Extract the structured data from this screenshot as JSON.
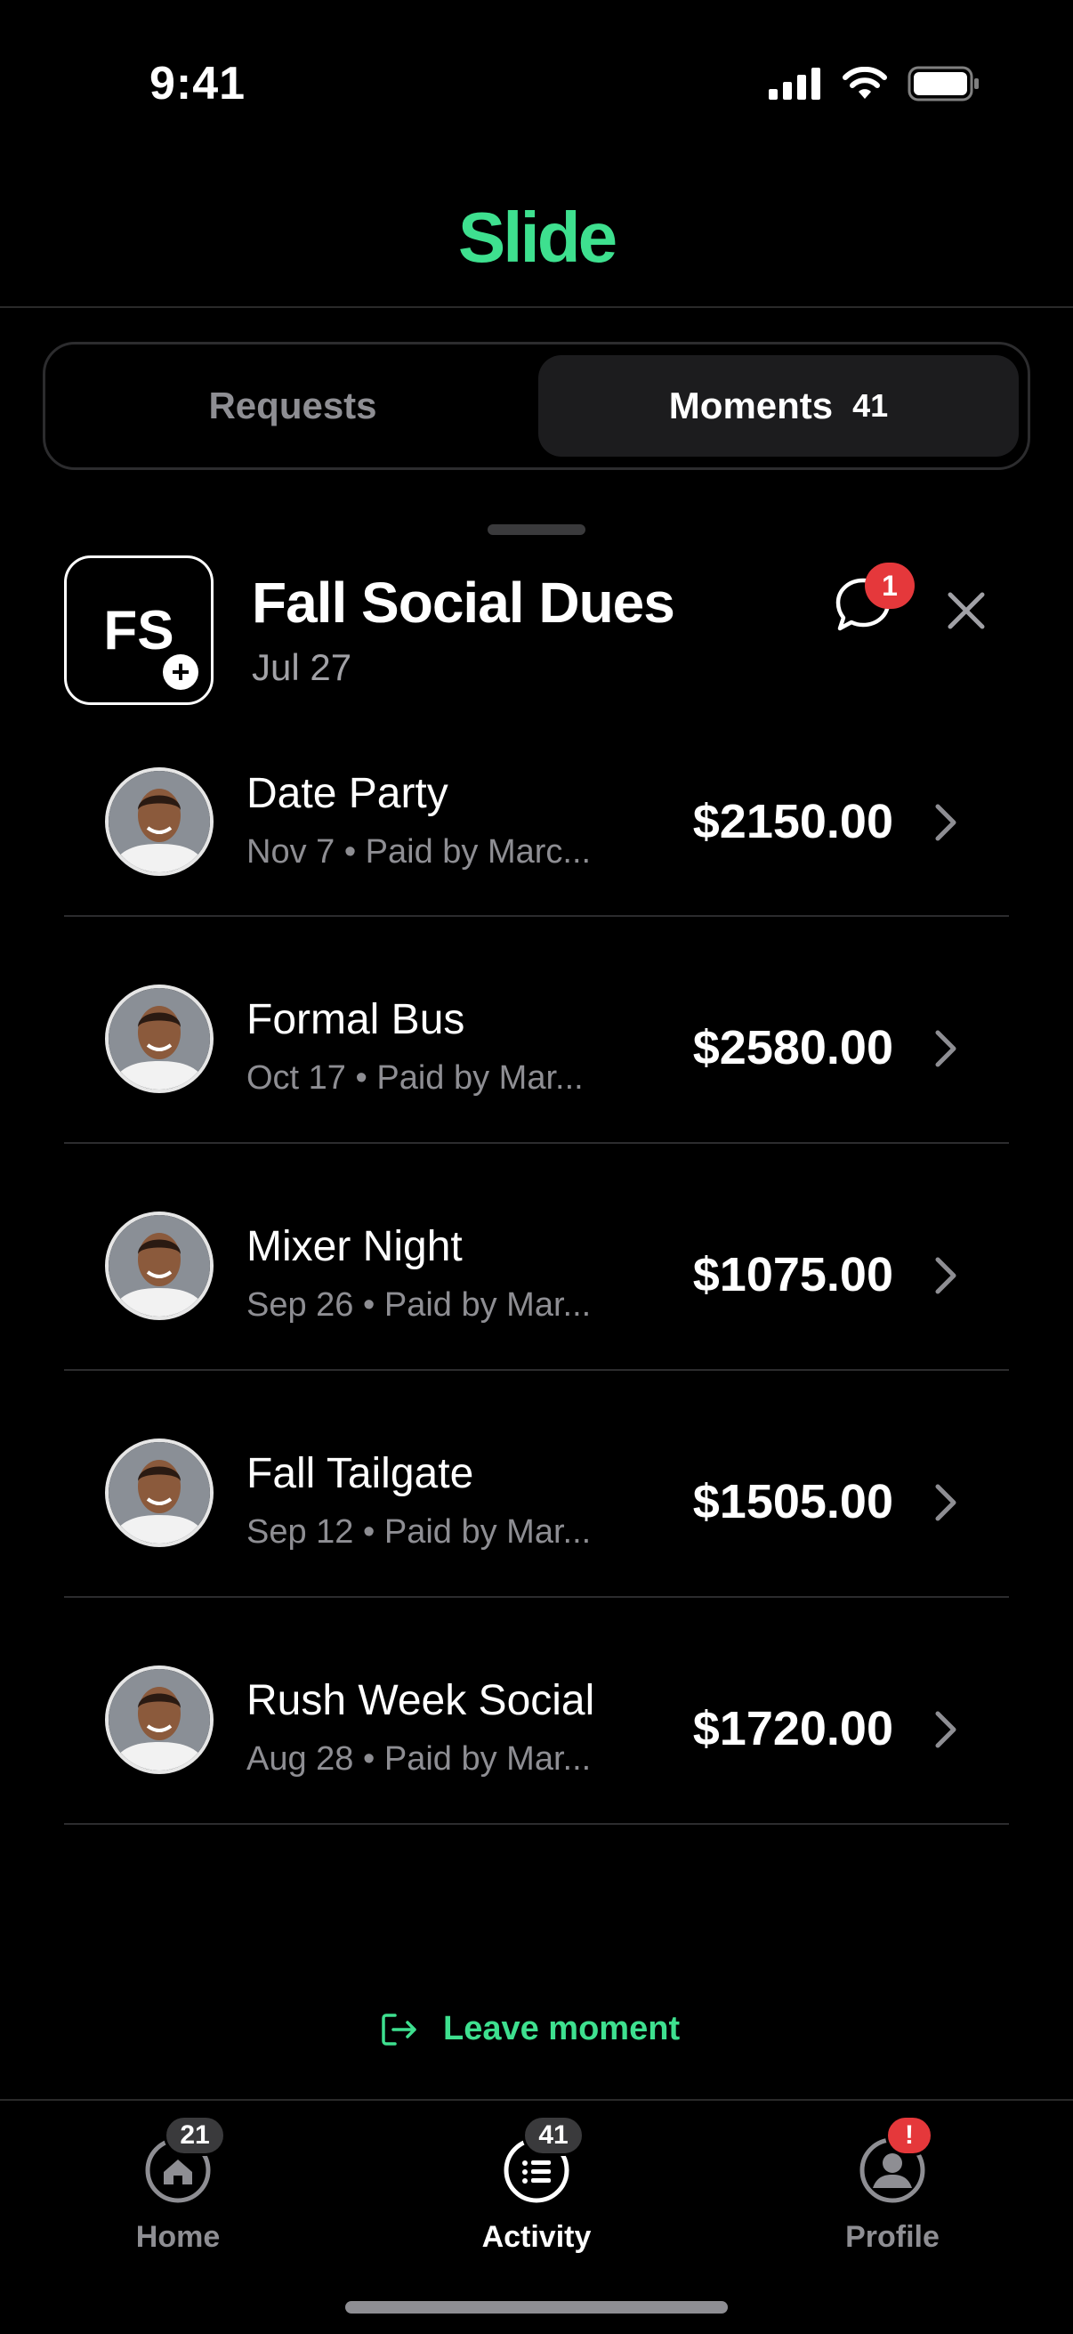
{
  "status_bar": {
    "time": "9:41"
  },
  "header": {
    "logo": "Slide"
  },
  "segments": {
    "requests_label": "Requests",
    "moments_label": "Moments",
    "moments_count": "41"
  },
  "moment": {
    "initials": "FS",
    "avatar_plus": "+",
    "title": "Fall Social Dues",
    "date": "Jul 27",
    "chat_badge": "1"
  },
  "items": [
    {
      "title": "Date Party",
      "subtitle": "Nov 7  •  Paid by Marc...",
      "amount": "$2150.00"
    },
    {
      "title": "Formal Bus",
      "subtitle": "Oct 17  •  Paid by Mar...",
      "amount": "$2580.00"
    },
    {
      "title": "Mixer Night",
      "subtitle": "Sep 26  •  Paid by Mar...",
      "amount": "$1075.00"
    },
    {
      "title": "Fall Tailgate",
      "subtitle": "Sep 12  •  Paid by Mar...",
      "amount": "$1505.00"
    },
    {
      "title": "Rush Week Social",
      "subtitle": "Aug 28  •  Paid by Mar...",
      "amount": "$1720.00"
    }
  ],
  "leave_label": "Leave moment",
  "tabs": {
    "home": {
      "label": "Home",
      "badge": "21"
    },
    "activity": {
      "label": "Activity",
      "badge": "41"
    },
    "profile": {
      "label": "Profile",
      "badge": "!"
    }
  },
  "colors": {
    "accent": "#3ee08f",
    "badge_red": "#e5383b",
    "background": "#000000"
  }
}
